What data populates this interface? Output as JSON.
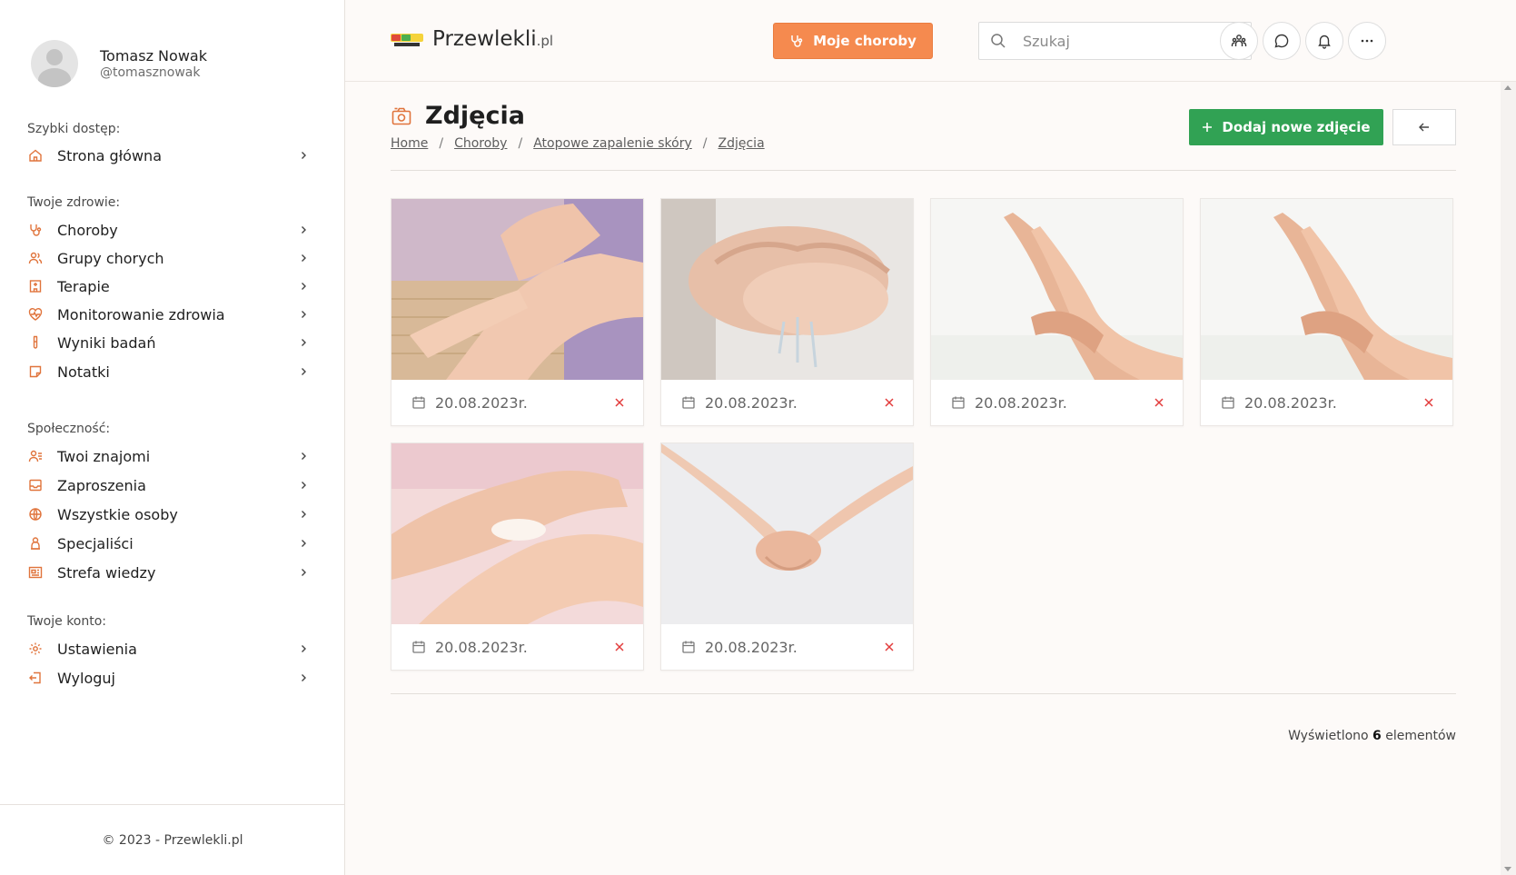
{
  "user": {
    "name": "Tomasz Nowak",
    "handle": "@tomasznowak"
  },
  "sidebar": {
    "sections": [
      {
        "label": "Szybki dostęp:",
        "items": [
          {
            "label": "Strona główna",
            "icon": "home-icon"
          }
        ]
      },
      {
        "label": "Twoje zdrowie:",
        "items": [
          {
            "label": "Choroby",
            "icon": "stethoscope-icon"
          },
          {
            "label": "Grupy chorych",
            "icon": "users-icon"
          },
          {
            "label": "Terapie",
            "icon": "hospital-icon"
          },
          {
            "label": "Monitorowanie zdrowia",
            "icon": "heart-pulse-icon"
          },
          {
            "label": "Wyniki badań",
            "icon": "test-tube-icon"
          },
          {
            "label": "Notatki",
            "icon": "note-icon"
          }
        ]
      },
      {
        "label": "Społeczność:",
        "items": [
          {
            "label": "Twoi znajomi",
            "icon": "friends-icon"
          },
          {
            "label": "Zaproszenia",
            "icon": "inbox-icon"
          },
          {
            "label": "Wszystkie osoby",
            "icon": "globe-icon"
          },
          {
            "label": "Specjaliści",
            "icon": "doctor-icon"
          },
          {
            "label": "Strefa wiedzy",
            "icon": "newspaper-icon"
          }
        ]
      },
      {
        "label": "Twoje konto:",
        "items": [
          {
            "label": "Ustawienia",
            "icon": "gear-icon"
          },
          {
            "label": "Wyloguj",
            "icon": "logout-icon"
          }
        ]
      }
    ],
    "footer": "© 2023 - Przewlekli.pl"
  },
  "header": {
    "logo_main": "Przewlekli",
    "logo_suffix": ".pl",
    "my_diseases_button": "Moje choroby",
    "search_placeholder": "Szukaj",
    "icons": [
      "group-icon",
      "chat-icon",
      "bell-icon",
      "more-icon"
    ]
  },
  "page": {
    "title": "Zdjęcia",
    "breadcrumb": [
      "Home",
      "Choroby",
      "Atopowe zapalenie skóry",
      "Zdjęcia"
    ],
    "add_button": "Dodaj nowe zdjęcie",
    "photos": [
      {
        "date": "20.08.2023r."
      },
      {
        "date": "20.08.2023r."
      },
      {
        "date": "20.08.2023r."
      },
      {
        "date": "20.08.2023r."
      },
      {
        "date": "20.08.2023r."
      },
      {
        "date": "20.08.2023r."
      }
    ],
    "count_prefix": "Wyświetlono",
    "count_value": "6",
    "count_suffix": "elementów"
  },
  "colors": {
    "accent": "#f58a4f",
    "icon_accent": "#e0743c",
    "primary_green": "#31a254",
    "delete_red": "#e23b3b"
  }
}
